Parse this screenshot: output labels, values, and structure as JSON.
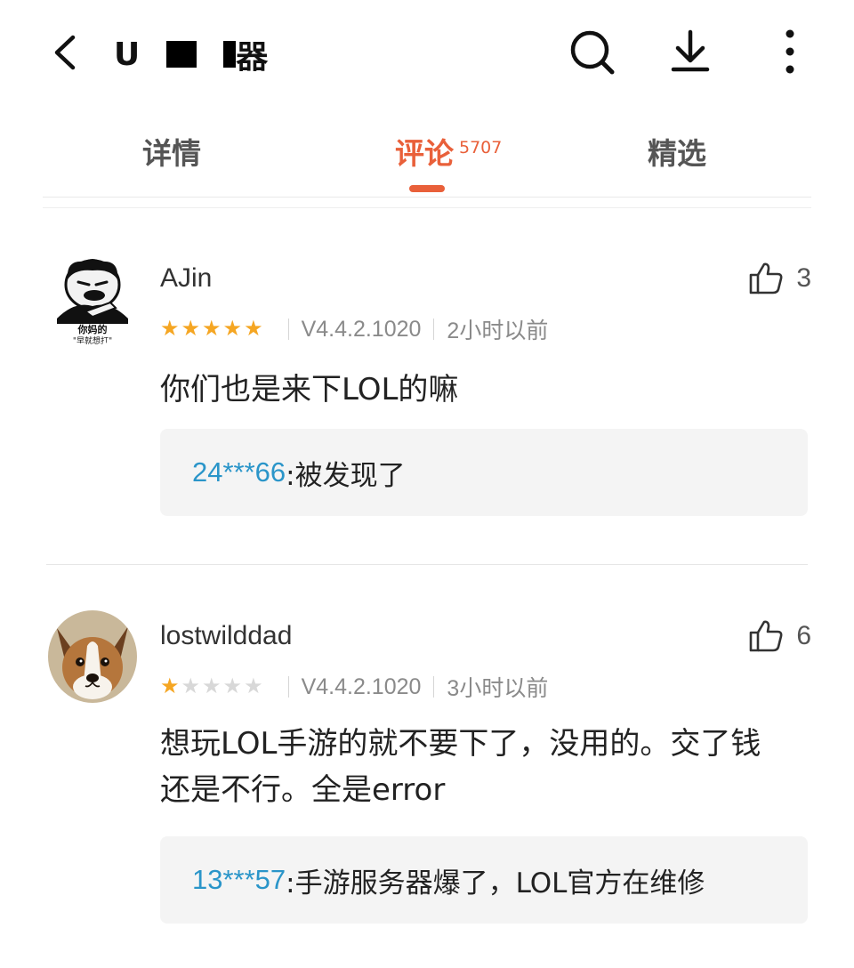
{
  "header": {
    "title_visible_start": "U",
    "title_visible_end": "器",
    "icons": [
      "back-icon",
      "search-icon",
      "download-icon",
      "more-icon"
    ]
  },
  "tabs": [
    {
      "label": "详情",
      "active": false
    },
    {
      "label": "评论",
      "count": "5707",
      "active": true
    },
    {
      "label": "精选",
      "active": false
    }
  ],
  "comments": [
    {
      "username": "AJin",
      "likes": "3",
      "rating": 5,
      "version": "V4.4.2.1020",
      "time": "2小时以前",
      "text": "你们也是来下LOL的嘛",
      "avatar_caption_1": "你妈的",
      "avatar_caption_2": "\"早就想打\"",
      "reply": {
        "user": "24***66",
        "text": ":被发现了"
      }
    },
    {
      "username": "lostwilddad",
      "likes": "6",
      "rating": 1,
      "version": "V4.4.2.1020",
      "time": "3小时以前",
      "text_line1": "想玩LOL手游的就不要下了，没用的。交了钱",
      "text_line2": "还是不行。全是error",
      "reply": {
        "user": "13***57",
        "text": ":手游服务器爆了，LOL官方在维修"
      }
    }
  ],
  "colors": {
    "accent": "#e9603a",
    "reply_user": "#2a95c9",
    "star_on": "#f5a623",
    "star_off": "#d8d8d8"
  }
}
